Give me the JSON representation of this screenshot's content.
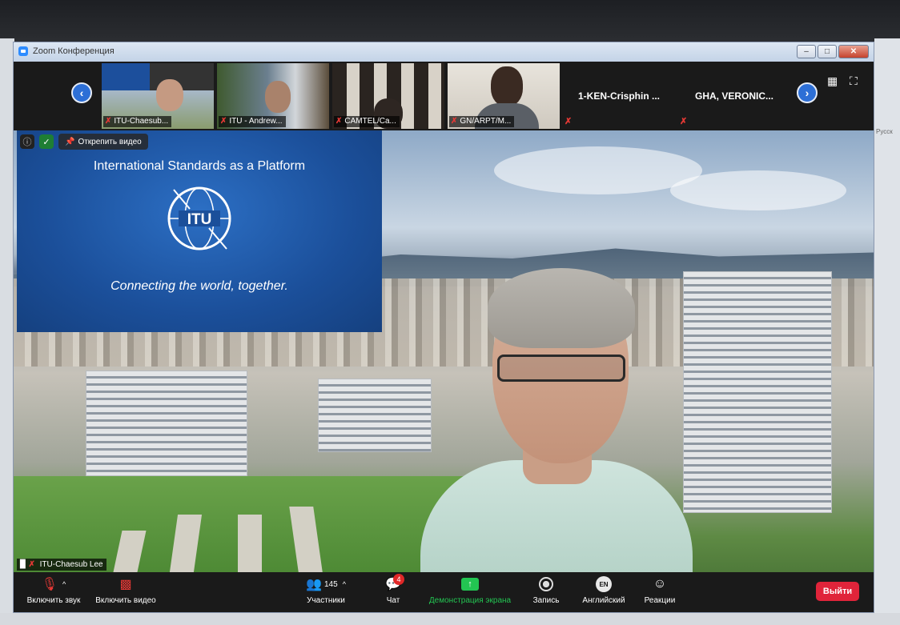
{
  "window": {
    "title": "Zoom Конференция"
  },
  "strip": {
    "tiles": [
      {
        "label": "ITU-Chaesub..."
      },
      {
        "label": "ITU - Andrew..."
      },
      {
        "label": "CAMTEL/Ca..."
      },
      {
        "label": "GN/ARPT/M..."
      }
    ],
    "name_tiles": [
      {
        "label": "1-KEN-Crisphin ..."
      },
      {
        "label": "GHA, VERONIC..."
      }
    ]
  },
  "main": {
    "unpin_label": "Открепить видео",
    "slide": {
      "title": "International Standards as a Platform",
      "logo_text": "ITU",
      "tagline": "Connecting the world, together."
    },
    "speaker_label": "ITU-Chaesub Lee"
  },
  "toolbar": {
    "audio": "Включить звук",
    "video": "Включить видео",
    "participants": "Участники",
    "participants_count": "145",
    "chat": "Чат",
    "chat_badge": "4",
    "share": "Демонстрация экрана",
    "record": "Запись",
    "language_code": "EN",
    "language": "Английский",
    "reactions": "Реакции",
    "leave": "Выйти"
  },
  "colors": {
    "accent": "#2d8cff",
    "share_green": "#23c552",
    "leave_red": "#e0243a",
    "muted_red": "#e53935"
  },
  "background": {
    "side_text": "Русск"
  }
}
